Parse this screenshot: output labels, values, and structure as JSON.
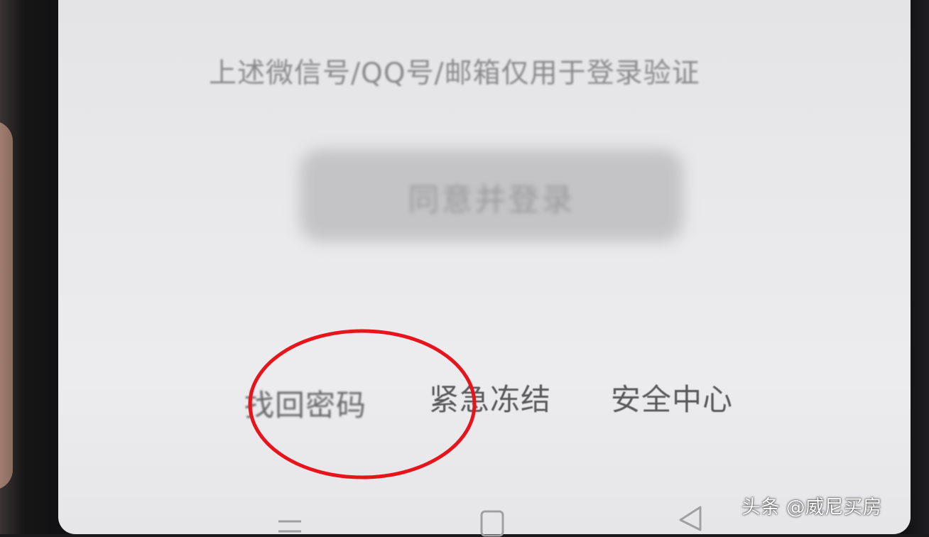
{
  "login_page": {
    "notice_text": "上述微信号/QQ号/邮箱仅用于登录验证",
    "agree_button_label": "同意并登录",
    "links": {
      "recover_password": "找回密码",
      "emergency_freeze": "紧急冻结",
      "security_center": "安全中心"
    }
  },
  "annotation": {
    "highlight_target": "找回密码",
    "highlight_color": "#e8141b"
  },
  "nav_bar": {
    "icons": [
      "menu-icon",
      "home-square-icon",
      "back-triangle-icon"
    ]
  },
  "watermark": {
    "text": "头条 @威尼买房"
  }
}
